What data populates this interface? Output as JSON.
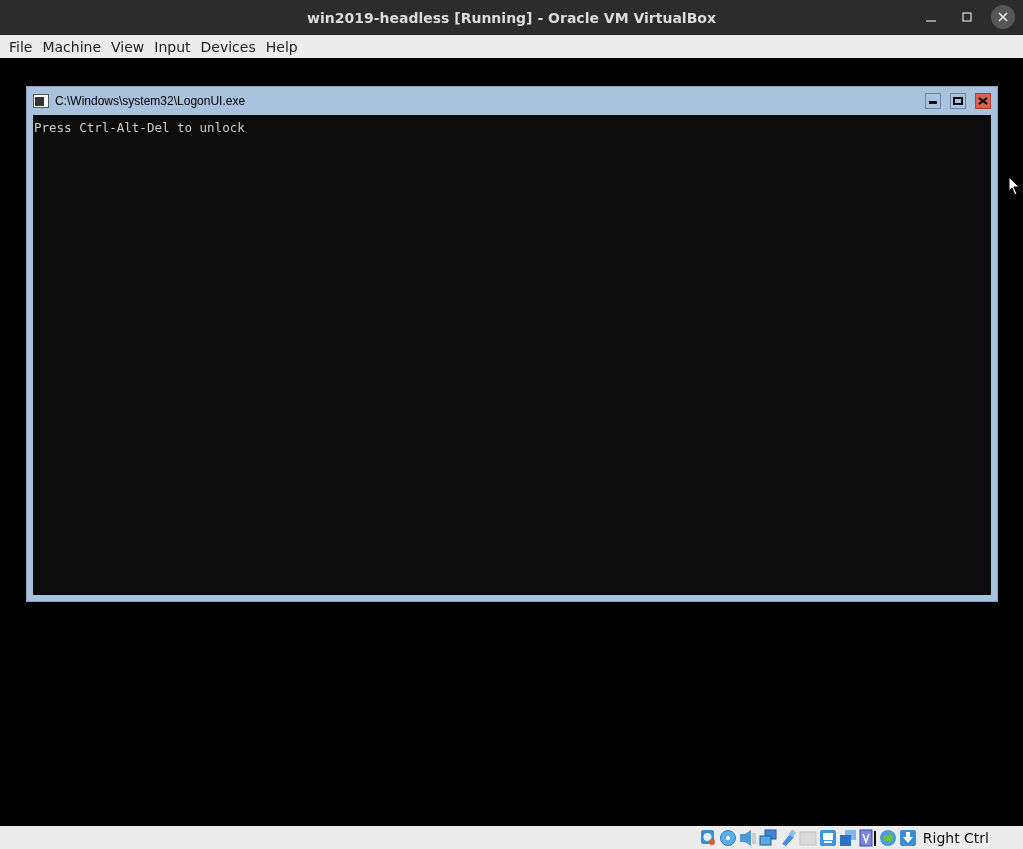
{
  "window": {
    "title": "win2019-headless [Running] - Oracle VM VirtualBox"
  },
  "menu": [
    "File",
    "Machine",
    "View",
    "Input",
    "Devices",
    "Help"
  ],
  "guest_window": {
    "title": "C:\\Windows\\system32\\LogonUI.exe",
    "console_text": "Press Ctrl-Alt-Del to unlock"
  },
  "status_bar": {
    "host_key": "Right Ctrl",
    "indicators": [
      {
        "kind": "disk"
      },
      {
        "kind": "optical"
      },
      {
        "kind": "audio"
      },
      {
        "kind": "network"
      },
      {
        "kind": "usb"
      },
      {
        "kind": "shared"
      },
      {
        "kind": "display"
      },
      {
        "kind": "capture"
      },
      {
        "kind": "recording"
      },
      {
        "kind": "mouse"
      },
      {
        "kind": "keyboard"
      }
    ]
  }
}
